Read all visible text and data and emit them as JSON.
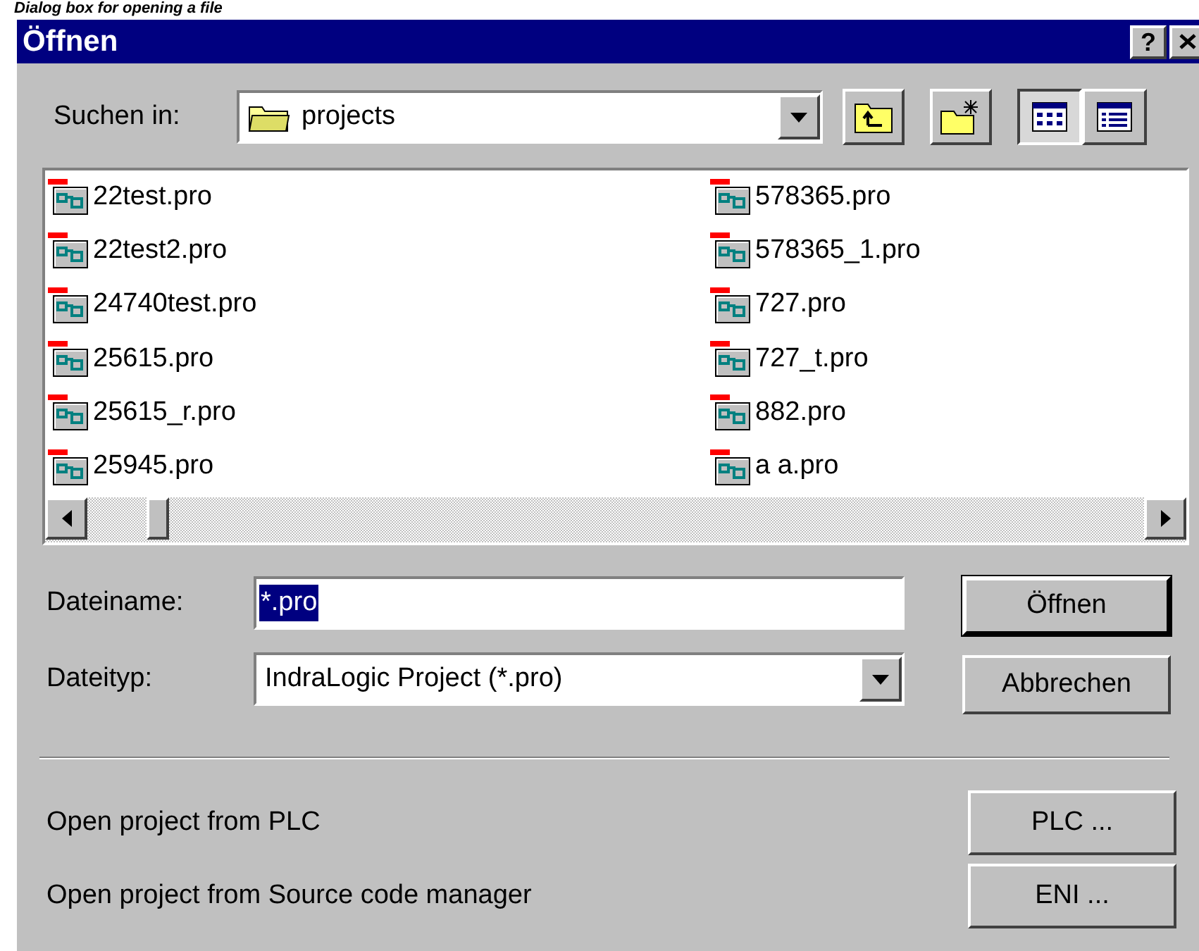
{
  "caption": "Dialog box for opening a file",
  "window": {
    "title": "Öffnen",
    "help": "?"
  },
  "look_in": {
    "label": "Suchen in:",
    "value": "projects"
  },
  "view_buttons": [
    {
      "kind": "list",
      "selected": true
    },
    {
      "kind": "details",
      "selected": false
    }
  ],
  "files": [
    {
      "name": "22test.pro"
    },
    {
      "name": "22test2.pro"
    },
    {
      "name": "24740test.pro"
    },
    {
      "name": "25615.pro"
    },
    {
      "name": "25615_r.pro"
    },
    {
      "name": "25945.pro"
    },
    {
      "name": "578365.pro"
    },
    {
      "name": "578365_1.pro"
    },
    {
      "name": "727.pro"
    },
    {
      "name": "727_t.pro"
    },
    {
      "name": "882.pro"
    },
    {
      "name": "a a.pro"
    }
  ],
  "filename": {
    "label": "Dateiname:",
    "value": "*.pro",
    "highlighted": true
  },
  "filetype": {
    "label": "Dateityp:",
    "value": "IndraLogic Project (*.pro)"
  },
  "buttons": [
    {
      "label": "Öffnen",
      "default": true
    },
    {
      "label": "Abbrechen",
      "default": false
    }
  ],
  "extras": [
    {
      "text": "Open project from PLC",
      "button": "PLC ..."
    },
    {
      "text": "Open project from Source code manager",
      "button": "ENI ..."
    }
  ]
}
